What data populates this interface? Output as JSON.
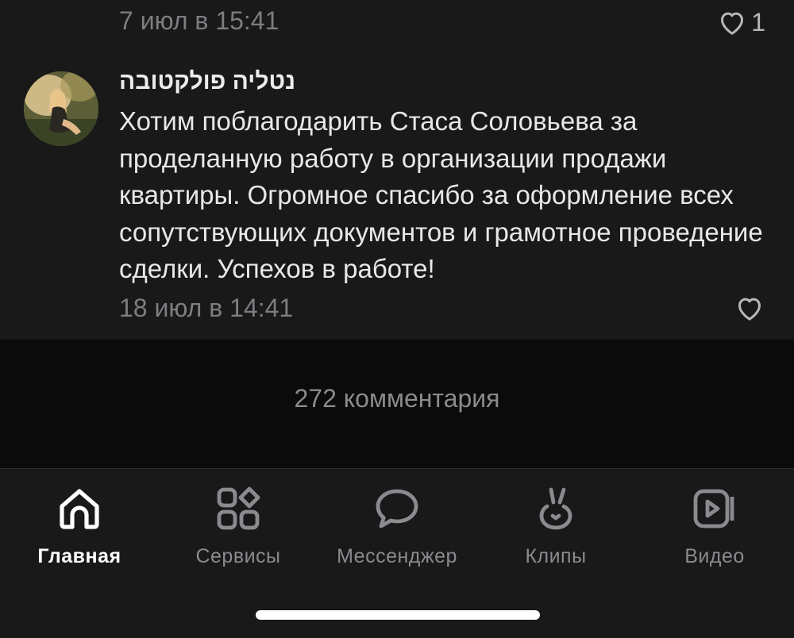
{
  "previous_comment": {
    "meta": "7 июл в 15:41",
    "like_count": "1"
  },
  "comment": {
    "author": "נטליה פולקטובה",
    "text": "Хотим поблагодарить Стаса Соловьева за проделанную работу в организации продажи квартиры. Огромное спасибо за оформление всех сопутствующих документов и грамотное проведение сделки. Успехов в работе!",
    "meta": "18 июл в 14:41"
  },
  "comments_count": "272 комментария",
  "tabbar": {
    "tabs": [
      {
        "label": "Главная",
        "icon": "home-icon",
        "active": true
      },
      {
        "label": "Сервисы",
        "icon": "services-grid-icon",
        "active": false
      },
      {
        "label": "Мессенджер",
        "icon": "chat-bubble-icon",
        "active": false
      },
      {
        "label": "Клипы",
        "icon": "clips-icon",
        "active": false
      },
      {
        "label": "Видео",
        "icon": "video-icon",
        "active": false
      }
    ]
  }
}
